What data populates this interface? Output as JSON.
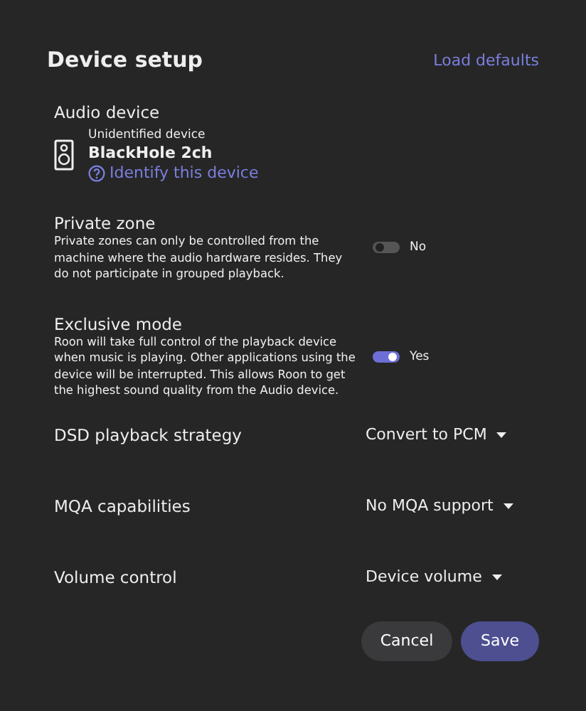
{
  "title": "Device setup",
  "load_defaults": "Load defaults",
  "audio_device": {
    "label": "Audio device",
    "status": "Unidentified device",
    "name": "BlackHole 2ch",
    "identify_link": "Identify this device"
  },
  "toggles": [
    {
      "label": "Private zone",
      "description": "Private zones can only be controlled from the machine where the audio hardware resides. They do not participate in grouped playback.",
      "on": false,
      "state_text": "No"
    },
    {
      "label": "Exclusive mode",
      "description": "Roon will take full control of the playback device when music is playing. Other applications using the device will be interrupted. This allows Roon to get the highest sound quality from the Audio device.",
      "on": true,
      "state_text": "Yes"
    }
  ],
  "dropdowns": [
    {
      "label": "DSD playback strategy",
      "value": "Convert to PCM"
    },
    {
      "label": "MQA capabilities",
      "value": "No MQA support"
    },
    {
      "label": "Volume control",
      "value": "Device volume"
    }
  ],
  "buttons": [
    {
      "label": "Cancel",
      "kind": "secondary"
    },
    {
      "label": "Save",
      "kind": "primary"
    }
  ]
}
